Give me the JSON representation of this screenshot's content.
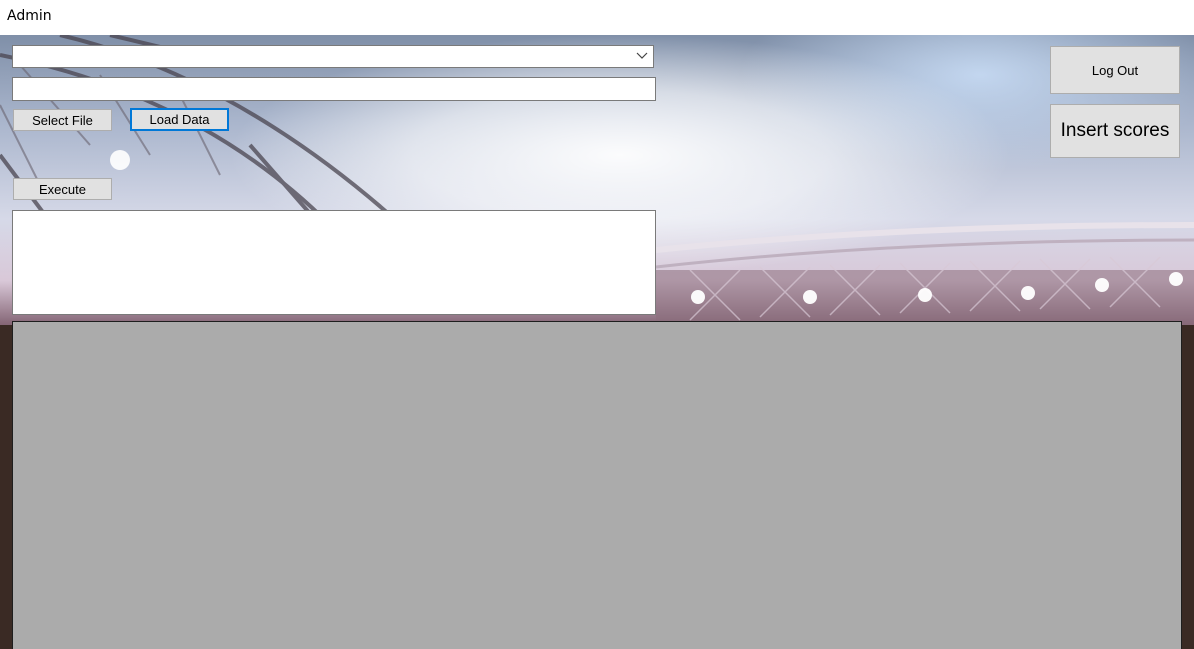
{
  "window": {
    "title": "Admin"
  },
  "form": {
    "table_select": {
      "value": ""
    },
    "file_path": {
      "value": ""
    },
    "select_file_label": "Select File",
    "load_data_label": "Load Data",
    "execute_label": "Execute",
    "query_output": {
      "value": ""
    }
  },
  "actions": {
    "log_out_label": "Log Out",
    "insert_scores_label": "Insert scores"
  },
  "icons": {
    "combo_arrow": "chevron-down-icon"
  },
  "colors": {
    "focus_border": "#0078d7",
    "button_face": "#e1e1e1",
    "grid_background": "#ababab"
  }
}
